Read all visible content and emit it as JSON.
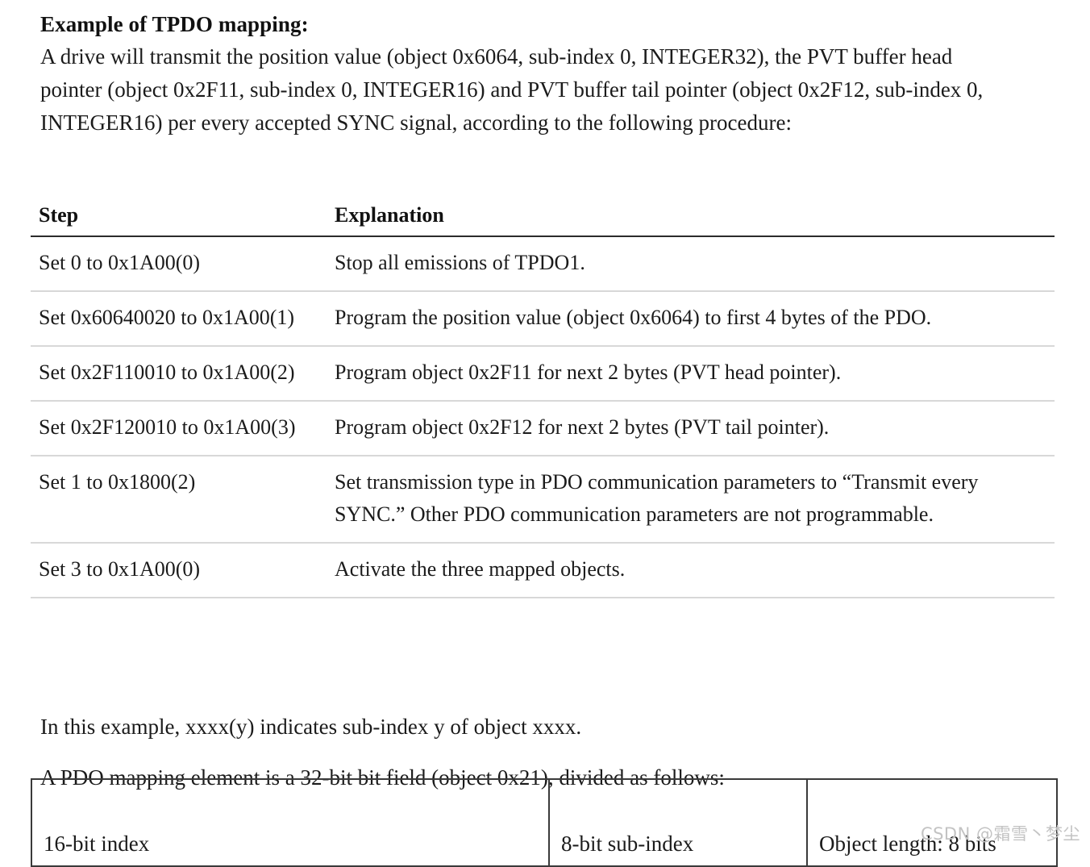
{
  "document": {
    "heading": "Example of TPDO mapping:",
    "intro_paragraph": "A drive will transmit the position value (object 0x6064, sub-index 0, INTEGER32), the PVT buffer head pointer (object 0x2F11, sub-index 0, INTEGER16) and PVT buffer tail pointer (object 0x2F12, sub-index 0, INTEGER16) per every accepted SYNC signal, according to the following procedure:"
  },
  "steps_table": {
    "columns": [
      "Step",
      "Explanation"
    ],
    "rows": [
      {
        "step": "Set 0 to 0x1A00(0)",
        "explanation": "Stop all emissions of TPDO1."
      },
      {
        "step": "Set 0x60640020 to 0x1A00(1)",
        "explanation": "Program the position value (object 0x6064) to first 4 bytes of the PDO."
      },
      {
        "step": "Set 0x2F110010 to 0x1A00(2)",
        "explanation": "Program object 0x2F11 for next 2 bytes (PVT head pointer)."
      },
      {
        "step": "Set 0x2F120010 to 0x1A00(3)",
        "explanation": "Program object 0x2F12 for next 2 bytes (PVT tail pointer)."
      },
      {
        "step": "Set 1 to 0x1800(2)",
        "explanation": "Set transmission type in PDO communication parameters to “Transmit every SYNC.” Other PDO communication parameters are not programmable."
      },
      {
        "step": "Set 3 to 0x1A00(0)",
        "explanation": "Activate the three mapped objects."
      }
    ]
  },
  "notes": {
    "example_note": "In this example, xxxx(y) indicates sub-index y of object xxxx.",
    "bitfield_note": "A PDO mapping element is a 32-bit bit field (object 0x21), divided as follows:"
  },
  "bitfield_table": {
    "cells": [
      "16-bit index",
      "8-bit sub-index",
      "Object length: 8 bits"
    ]
  },
  "watermark": {
    "text": "CSDN @霜雪丶梦尘"
  },
  "colors": {
    "text": "#1b1b1b",
    "header_rule": "#2b2b2b",
    "row_rule": "#d8d8d8",
    "bitfield_border": "#3a3a3a",
    "watermark": "#c3c3c3"
  }
}
